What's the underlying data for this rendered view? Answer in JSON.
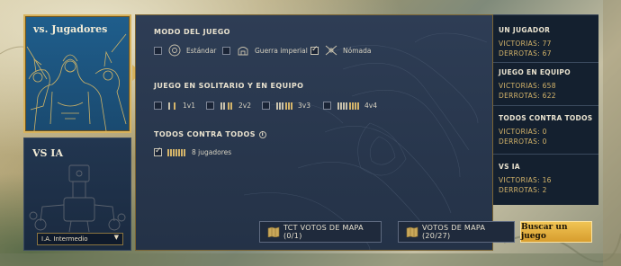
{
  "vs_players_card": {
    "title": "vs. Jugadores"
  },
  "vs_ai_card": {
    "title": "VS IA",
    "difficulty_selected": "I.A. Intermedio"
  },
  "game_mode": {
    "section_label": "MODO DEL JUEGO",
    "options": [
      {
        "label": "Estándar",
        "checked": false,
        "icon": "standard-mode-icon"
      },
      {
        "label": "Guerra imperial",
        "checked": false,
        "icon": "imperial-war-icon"
      },
      {
        "label": "Nómada",
        "checked": true,
        "icon": "nomad-icon"
      }
    ]
  },
  "solo_team": {
    "section_label": "JUEGO EN SOLITARIO Y EN EQUIPO",
    "options": [
      {
        "label": "1v1",
        "checked": false
      },
      {
        "label": "2v2",
        "checked": false
      },
      {
        "label": "3v3",
        "checked": false
      },
      {
        "label": "4v4",
        "checked": false
      }
    ]
  },
  "ffa": {
    "section_label": "TODOS CONTRA TODOS",
    "info_icon": "i",
    "options": [
      {
        "label": "8 jugadores",
        "checked": true
      }
    ]
  },
  "footer": {
    "tct_votes_label": "TCT VOTOS DE MAPA (0/1)",
    "map_votes_label": "VOTOS DE MAPA (20/27)",
    "find_game_label": "Buscar un juego"
  },
  "stats": {
    "one_player": {
      "title": "UN JUGADOR",
      "wins": "VICTORIAS: 77",
      "losses": "DERROTAS: 67"
    },
    "team": {
      "title": "JUEGO EN EQUIPO",
      "wins": "VICTORIAS: 658",
      "losses": "DERROTAS: 622"
    },
    "ffa": {
      "title": "TODOS CONTRA TODOS",
      "wins": "VICTORIAS: 0",
      "losses": "DERROTAS: 0"
    },
    "ai": {
      "title": "VS IA",
      "wins": "VICTORIAS: 16",
      "losses": "DERROTAS: 2"
    }
  },
  "colors": {
    "accent_gold": "#d7b25c",
    "stat_gold": "#d4b46a",
    "primary_button": "#e6ae3e"
  }
}
